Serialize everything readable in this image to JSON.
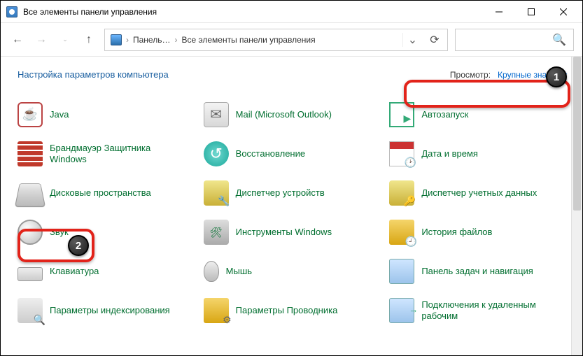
{
  "window": {
    "title": "Все элементы панели управления"
  },
  "addressbar": {
    "seg1": "Панель…",
    "seg2": "Все элементы панели управления"
  },
  "heading": "Настройка параметров компьютера",
  "view": {
    "label": "Просмотр:",
    "value": "Крупные значки"
  },
  "items": {
    "java": "Java",
    "mail": "Mail (Microsoft Outlook)",
    "autorun": "Автозапуск",
    "firewall": "Брандмауэр Защитника Windows",
    "restore": "Восстановление",
    "datetime": "Дата и время",
    "diskspace": "Дисковые пространства",
    "devmgr": "Диспетчер устройств",
    "credmgr": "Диспетчер учетных данных",
    "sound": "Звук",
    "wintools": "Инструменты Windows",
    "history": "История файлов",
    "keyboard": "Клавиатура",
    "mouse": "Мышь",
    "taskbar": "Панель задач и навигация",
    "indexing": "Параметры индексирования",
    "explorer": "Параметры Проводника",
    "remote": "Подключения к удаленным рабочим"
  },
  "annotations": {
    "b1": "1",
    "b2": "2"
  }
}
